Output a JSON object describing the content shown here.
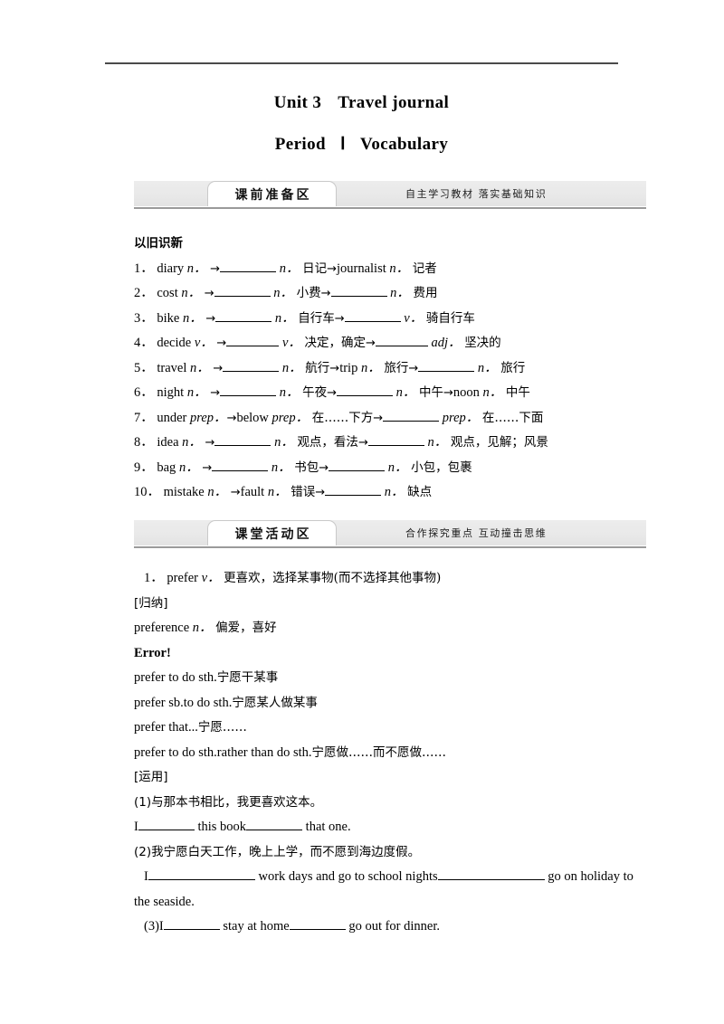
{
  "document": {
    "title_unit": "Unit 3",
    "title_name": "Travel journal",
    "subtitle_period": "Period",
    "subtitle_roman": "Ⅰ",
    "subtitle_name": "Vocabulary"
  },
  "sections": [
    {
      "tab_label": "课前准备区",
      "motto": "自主学习教材 落实基础知识",
      "heading": "以旧识新",
      "items": [
        {
          "num": "1．",
          "word": "diary",
          "pos": "n．",
          "mid_pos": "n．",
          "mid_cn": "日记",
          "tail": "journalist",
          "tail_pos": "n．",
          "tail_cn": "记者"
        },
        {
          "num": "2．",
          "word": "cost",
          "pos": "n．",
          "mid_pos": "n．",
          "mid_cn": "小费",
          "tail_pos": "n．",
          "tail_cn": "费用"
        },
        {
          "num": "3．",
          "word": "bike",
          "pos": "n．",
          "mid_pos": "n．",
          "mid_cn": "自行车",
          "tail_pos": "v．",
          "tail_cn": "骑自行车"
        },
        {
          "num": "4．",
          "word": "decide",
          "pos": "v．",
          "mid_pos": "v．",
          "mid_cn": "决定，确定",
          "tail_pos": "adj．",
          "tail_cn": "坚决的"
        },
        {
          "num": "5．",
          "word": "travel",
          "pos": "n．",
          "mid_pos": "n．",
          "mid_cn": "航行",
          "mid2": "trip",
          "mid2_pos": "n．",
          "mid2_cn": "旅行",
          "tail_pos": "n．",
          "tail_cn": "旅行"
        },
        {
          "num": "6．",
          "word": "night",
          "pos": "n．",
          "mid_pos": "n．",
          "mid_cn": "午夜",
          "tail_pos": "n．",
          "tail_cn": "中午",
          "tail2": "noon",
          "tail2_pos": "n．",
          "tail2_cn": "中午"
        },
        {
          "num": "7．",
          "word": "under",
          "pos": "prep．",
          "mid_word": "below",
          "mid_pos": "prep．",
          "mid_cn": "在……下方",
          "tail_pos": "prep．",
          "tail_cn": "在……下面"
        },
        {
          "num": "8．",
          "word": "idea",
          "pos": "n．",
          "mid_pos": "n．",
          "mid_cn": "观点，看法",
          "tail_pos": "n．",
          "tail_cn": "观点，见解；风景"
        },
        {
          "num": "9．",
          "word": "bag",
          "pos": "n．",
          "mid_pos": "n．",
          "mid_cn": "书包",
          "tail_pos": "n．",
          "tail_cn": "小包，包裹"
        },
        {
          "num": "10．",
          "word": "mistake",
          "pos": "n．",
          "mid_word": "fault",
          "mid_pos": "n．",
          "mid_cn": "错误",
          "tail_pos": "n．",
          "tail_cn": "缺点"
        }
      ]
    },
    {
      "tab_label": "课堂活动区",
      "motto": "合作探究重点 互动撞击思维",
      "entry_num": "1．",
      "entry_word": "prefer",
      "entry_pos": "v．",
      "entry_cn": "更喜欢，选择某事物(而不选择其他事物)",
      "guina_label": "[归纳]",
      "preference_word": "preference",
      "preference_pos": "n．",
      "preference_cn": "偏爱，喜好",
      "error_label": "Error!",
      "patterns": [
        {
          "en": "prefer to do sth.",
          "cn": "宁愿干某事"
        },
        {
          "en": "prefer sb.to do sth.",
          "cn": "宁愿某人做某事"
        },
        {
          "en": "prefer that...",
          "cn": "宁愿……"
        },
        {
          "en": "prefer to do sth.rather than do sth.",
          "cn": "宁愿做……而不愿做……"
        }
      ],
      "yunyong_label": "[运用]",
      "exercises": [
        {
          "num": "(1)",
          "prompt": "与那本书相比，我更喜欢这本。",
          "a": "I",
          "b": "this book",
          "c": "that one."
        },
        {
          "num": "(2)",
          "prompt": "我宁愿白天工作，晚上上学，而不愿到海边度假。",
          "a": "I",
          "b": "work days and go to school nights",
          "c": "go on holiday to",
          "d": "the seaside."
        },
        {
          "num": "(3)",
          "a": "I",
          "b": "stay at home",
          "c": "go out for dinner."
        }
      ]
    }
  ],
  "glyphs": {
    "arrow": "→"
  }
}
